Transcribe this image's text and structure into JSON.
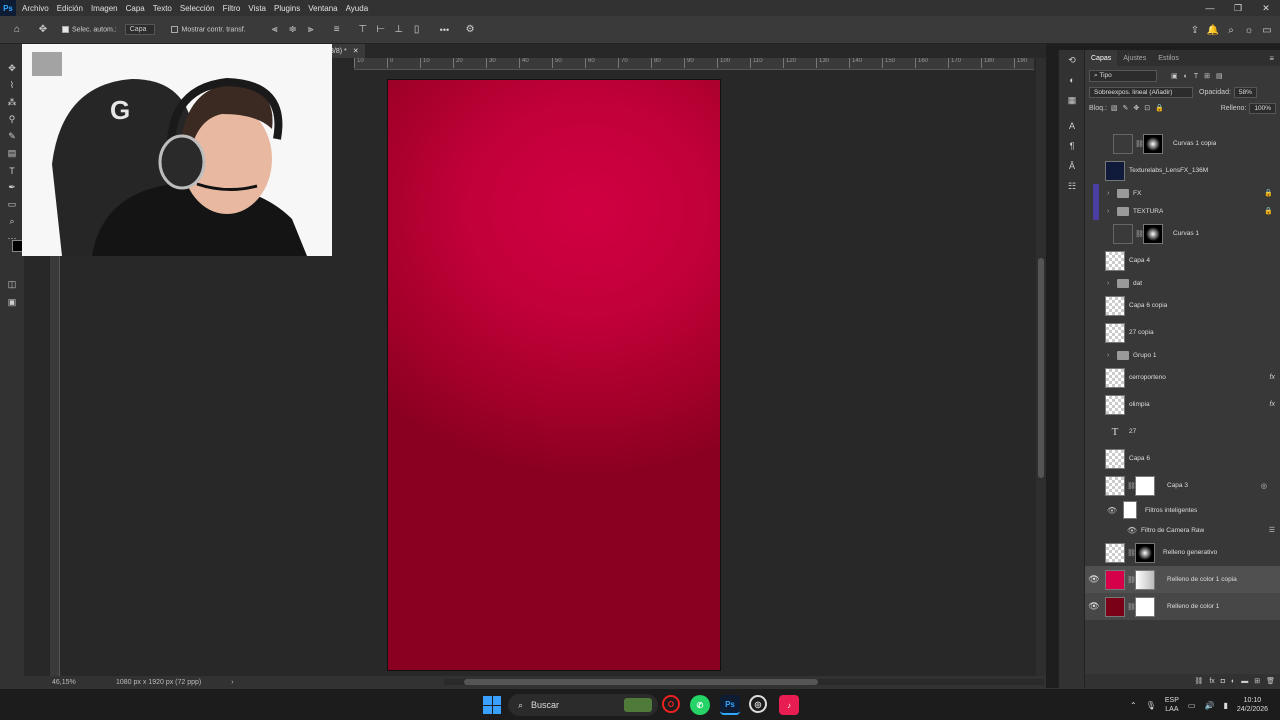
{
  "app": {
    "logo": "Ps"
  },
  "menu": [
    "Archivo",
    "Edición",
    "Imagen",
    "Capa",
    "Texto",
    "Selección",
    "Filtro",
    "Vista",
    "Plugins",
    "Ventana",
    "Ayuda"
  ],
  "options_bar": {
    "auto_select_label": "Selec. autom.:",
    "auto_select_value": "Capa",
    "show_transform_label": "Mostrar contr. transf.",
    "more": "•••"
  },
  "document": {
    "tab_title": "8/8) *",
    "ruler_ticks": [
      "10",
      "0",
      "10",
      "20",
      "30",
      "40",
      "50",
      "60",
      "70",
      "80",
      "90",
      "100",
      "110",
      "120",
      "130",
      "140",
      "150",
      "160",
      "170",
      "180",
      "190"
    ],
    "zoom": "46,15%",
    "doc_info": "1080 px x 1920 px (72 ppp)"
  },
  "layers_panel": {
    "tabs": [
      "Capas",
      "Ajustes",
      "Estilos"
    ],
    "filter_label": "Tipo",
    "blend_mode": "Sobreexpos. lineal (Añadir)",
    "opacity_label": "Opacidad:",
    "opacity_value": "58%",
    "lock_label": "Bloq.:",
    "fill_label": "Relleno:",
    "fill_value": "100%",
    "layers": [
      {
        "name": "Curvas 1 copia",
        "kind": "adjustment"
      },
      {
        "name": "Texturelabs_LensFX_136M",
        "kind": "image"
      },
      {
        "name": "FX",
        "kind": "group",
        "locked": true
      },
      {
        "name": "TEXTURA",
        "kind": "group",
        "locked": true
      },
      {
        "name": "Curvas 1",
        "kind": "adjustment"
      },
      {
        "name": "Capa 4",
        "kind": "pixel"
      },
      {
        "name": "dat",
        "kind": "group"
      },
      {
        "name": "Capa 6 copia",
        "kind": "pixel"
      },
      {
        "name": "27 copia",
        "kind": "pixel"
      },
      {
        "name": "Grupo 1",
        "kind": "group"
      },
      {
        "name": "cerroporteno",
        "kind": "pixel",
        "fx": true
      },
      {
        "name": "olimpia",
        "kind": "pixel",
        "fx": true
      },
      {
        "name": "27",
        "kind": "text"
      },
      {
        "name": "Capa 6",
        "kind": "pixel"
      },
      {
        "name": "Capa 3",
        "kind": "smart"
      },
      {
        "name": "Filtros inteligentes",
        "kind": "filter-head"
      },
      {
        "name": "Filtro de Camera Raw",
        "kind": "filter"
      },
      {
        "name": "Relleno generativo",
        "kind": "generative"
      },
      {
        "name": "Relleno de color 1 copia",
        "kind": "fill",
        "color": "#d6004a",
        "visible": true
      },
      {
        "name": "Relleno de color 1",
        "kind": "fill",
        "color": "#7a0018",
        "visible": true
      }
    ],
    "fx_label": "fx"
  },
  "taskbar": {
    "search_placeholder": "Buscar",
    "lang_top": "ESP",
    "lang_bottom": "LAA",
    "time": "10:10",
    "date": "24/2/2026"
  },
  "colors": {
    "canvas_center": "#d00042",
    "canvas_edge": "#8a0020",
    "foreground": "#000000",
    "background": "#f3eaa4",
    "accent": "#31a8ff"
  }
}
